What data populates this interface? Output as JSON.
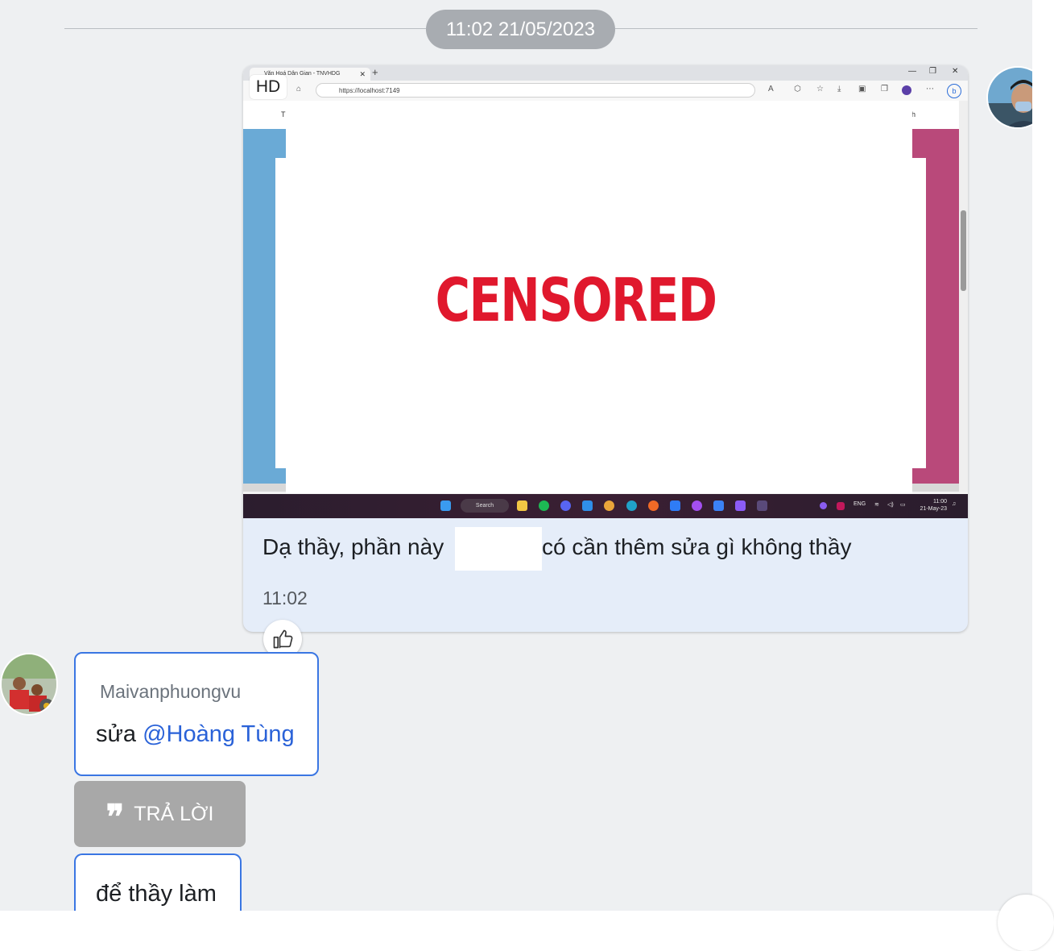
{
  "date_divider": "11:02 21/05/2023",
  "my_message": {
    "hd_badge": "HD",
    "image": {
      "browser_tab_title": "Văn Hoá Dân Gian - TNVHDG",
      "url": "https://localhost:7149",
      "censor_label": "CENSORED",
      "taskbar_search": "Search",
      "tray_lang": "ENG",
      "clock_time": "11:00",
      "clock_date": "21-May-23",
      "menu_left": "T",
      "menu_right": "h"
    },
    "text_before": "Dạ thầy, phần này",
    "text_after": "có cần thêm sửa gì không thầy",
    "time": "11:02"
  },
  "reply_message": {
    "sender": "Maivanphuongvu",
    "text": "sửa",
    "mention": "@Hoàng Tùng"
  },
  "reply_button_label": "TRẢ LỜI",
  "next_message_text": "để thầy làm",
  "colors": {
    "chat_bg": "#eef0f2",
    "my_bubble": "#e5edf9",
    "accent": "#3a76e3",
    "mention": "#2a62d8",
    "censor_red": "#e0182d"
  },
  "icons": [
    "thumbs-up-icon",
    "quote-icon"
  ]
}
